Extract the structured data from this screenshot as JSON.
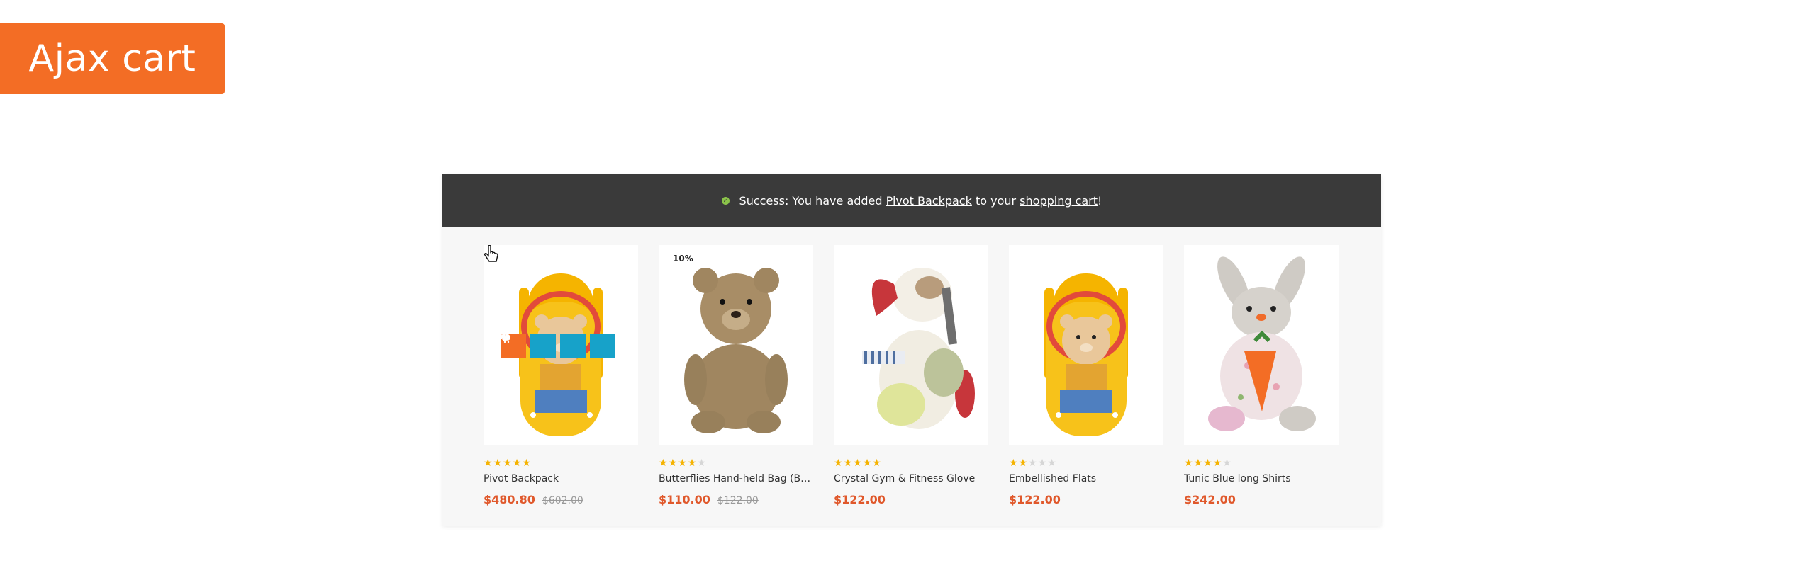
{
  "badge": {
    "label": "Ajax cart"
  },
  "alert": {
    "prefix": "Success: You have added ",
    "product_link": "Pivot Backpack",
    "middle": " to your ",
    "cart_link": "shopping cart",
    "suffix": "!",
    "icon": "check-circle-icon",
    "status_color": "#8bc34a"
  },
  "colors": {
    "accent": "#f36d25",
    "price": "#e0582b",
    "action_blue": "#17a2c9",
    "star": "#f5b301"
  },
  "products": [
    {
      "name": "Pivot Backpack",
      "rating": 5,
      "price": "$480.80",
      "old_price": "$602.00",
      "discount": "",
      "image": "teddy-backpack"
    },
    {
      "name": "Butterflies Hand-held Bag (Beige)",
      "rating": 4,
      "price": "$110.00",
      "old_price": "$122.00",
      "discount": "10%",
      "image": "brown-teddy-bear"
    },
    {
      "name": "Crystal Gym & Fitness Glove",
      "rating": 5,
      "price": "$122.00",
      "old_price": "",
      "discount": "",
      "image": "plush-dog"
    },
    {
      "name": "Embellished Flats",
      "rating": 2,
      "price": "$122.00",
      "old_price": "",
      "discount": "",
      "image": "teddy-backpack"
    },
    {
      "name": "Tunic Blue long Shirts",
      "rating": 4,
      "price": "$242.00",
      "old_price": "",
      "discount": "",
      "image": "plush-bunny"
    }
  ],
  "hover_actions": [
    "cart-icon",
    "eye-icon",
    "heart-icon",
    "compare-icon"
  ]
}
